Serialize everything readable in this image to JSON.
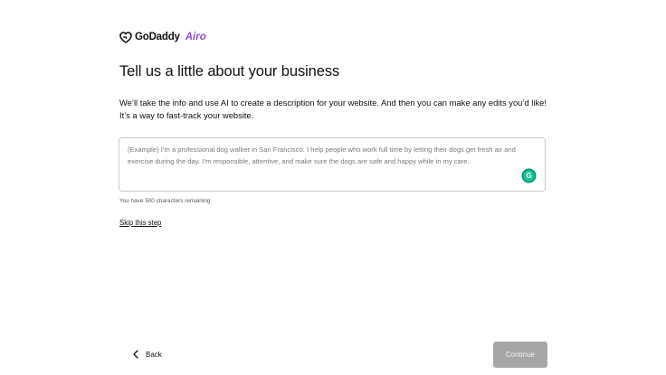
{
  "brand": {
    "name": "GoDaddy",
    "product": "Airo",
    "accent_color": "#8a4fd6"
  },
  "heading": {
    "title": "Tell us a little about your business",
    "intro": "We’ll take the info and use AI to create a description for your website. And then you can make any edits you’d like! It’s a way to fast-track your website."
  },
  "description_field": {
    "value": "",
    "placeholder": "(Example) I’m a professional dog walker in San Francisco. I help people who work full time by letting their dogs get fresh air and exercise during the day. I’m responsible, attentive, and make sure the dogs are safe and happy while in my care.",
    "assistant_icon": "grammarly-icon",
    "assistant_glyph": "G",
    "chars_remaining_text": "You have 500 characters remaining"
  },
  "links": {
    "skip": "Skip this step"
  },
  "footer": {
    "back_label": "Back",
    "back_icon": "chevron-left-icon",
    "continue_label": "Continue",
    "continue_disabled": true
  }
}
